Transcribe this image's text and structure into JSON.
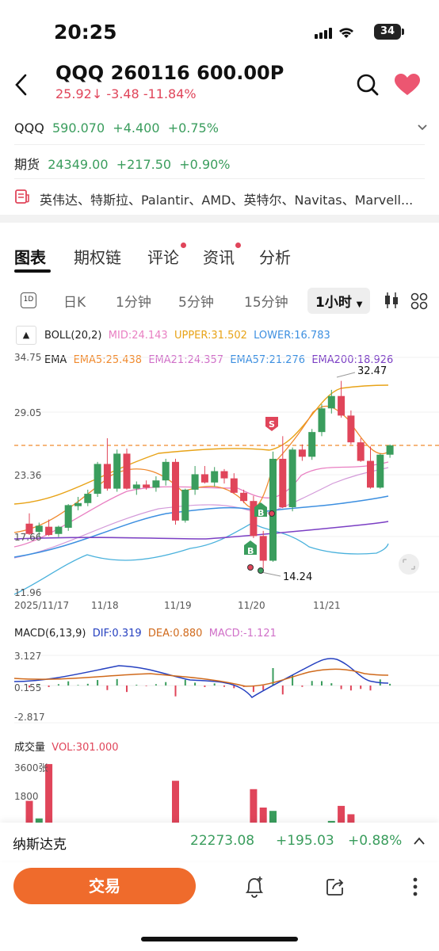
{
  "status": {
    "time": "20:25",
    "battery": "34"
  },
  "header": {
    "title": "QQQ 260116 600.00P",
    "price": "25.92",
    "change": "-3.48",
    "change_pct": "-11.84%"
  },
  "underlying": {
    "symbol": "QQQ",
    "price": "590.070",
    "change": "+4.400",
    "change_pct": "+0.75%"
  },
  "futures": {
    "label": "期货",
    "price": "24349.00",
    "change": "+217.50",
    "change_pct": "+0.90%"
  },
  "news_ticker": "英伟达、特斯拉、Palantir、AMD、英特尔、Navitas、Marvell...",
  "tabs": [
    {
      "label": "图表"
    },
    {
      "label": "期权链"
    },
    {
      "label": "评论"
    },
    {
      "label": "资讯"
    },
    {
      "label": "分析"
    }
  ],
  "periods": {
    "icon_label": "1D",
    "items": [
      "日K",
      "1分钟",
      "5分钟",
      "15分钟"
    ],
    "active": "1小时"
  },
  "boll": {
    "name": "BOLL(20,2)",
    "mid": "MID:24.143",
    "upper": "UPPER:31.502",
    "lower": "LOWER:16.783"
  },
  "ema": {
    "name": "EMA",
    "ema5": "EMA5:25.438",
    "ema21": "EMA21:24.357",
    "ema57": "EMA57:21.276",
    "ema200": "EMA200:18.926"
  },
  "price_axis": [
    "34.75",
    "29.05",
    "23.36",
    "17.66",
    "11.96"
  ],
  "date_axis": [
    "2025/11/17",
    "11/18",
    "11/19",
    "11/20",
    "11/21"
  ],
  "price_annotations": {
    "high": "32.47",
    "low": "14.24"
  },
  "markers": {
    "buy": "B",
    "sell": "S"
  },
  "macd": {
    "name": "MACD(6,13,9)",
    "dif": "DIF:0.319",
    "dea": "DEA:0.880",
    "macd": "MACD:-1.121",
    "axis": [
      "3.127",
      "0.155",
      "-2.817"
    ]
  },
  "volume": {
    "name": "成交量",
    "vol": "VOL:301.000",
    "axis": [
      "3600张",
      "1800"
    ]
  },
  "index_bar": {
    "name": "纳斯达克",
    "price": "22273.08",
    "change": "+195.03",
    "change_pct": "+0.88%"
  },
  "trade_label": "交易",
  "colors": {
    "up": "#3a9d5d",
    "down": "#e0455a",
    "accent": "#ef6b2c"
  },
  "chart_data": {
    "type": "candlestick",
    "x": [
      "2025/11/17",
      "11/18",
      "11/19",
      "11/20",
      "11/21"
    ],
    "ylim": [
      11.96,
      34.75
    ],
    "candles": [
      [
        18.6,
        19.6,
        17.5,
        17.6
      ],
      [
        17.8,
        18.7,
        17.3,
        18.4
      ],
      [
        18.3,
        19.0,
        17.4,
        17.5
      ],
      [
        17.6,
        18.4,
        17.3,
        18.3
      ],
      [
        18.2,
        20.5,
        17.9,
        20.4
      ],
      [
        20.3,
        21.2,
        19.9,
        20.6
      ],
      [
        20.6,
        21.9,
        20.3,
        21.5
      ],
      [
        21.5,
        24.6,
        21.2,
        24.4
      ],
      [
        24.4,
        26.9,
        21.8,
        22.0
      ],
      [
        22.0,
        25.8,
        21.7,
        25.4
      ],
      [
        25.4,
        25.9,
        21.9,
        22.0
      ],
      [
        22.0,
        22.7,
        21.4,
        22.4
      ],
      [
        22.4,
        22.8,
        21.9,
        22.1
      ],
      [
        22.1,
        23.2,
        21.7,
        22.8
      ],
      [
        22.8,
        24.9,
        22.3,
        24.6
      ],
      [
        24.6,
        24.9,
        18.5,
        18.9
      ],
      [
        18.9,
        22.0,
        18.7,
        21.9
      ],
      [
        21.9,
        24.2,
        21.4,
        23.4
      ],
      [
        23.4,
        24.2,
        22.5,
        22.6
      ],
      [
        22.6,
        24.1,
        22.2,
        23.7
      ],
      [
        23.7,
        23.9,
        22.5,
        23.0
      ],
      [
        23.0,
        23.5,
        21.5,
        21.6
      ],
      [
        21.6,
        21.9,
        20.6,
        20.8
      ],
      [
        20.8,
        21.3,
        17.2,
        17.4
      ],
      [
        17.4,
        17.9,
        14.24,
        15.0
      ],
      [
        15.0,
        25.6,
        14.9,
        24.9
      ],
      [
        24.9,
        27.1,
        20.1,
        20.2
      ],
      [
        20.2,
        26.0,
        19.8,
        25.8
      ],
      [
        25.8,
        26.3,
        24.7,
        25.1
      ],
      [
        25.1,
        27.8,
        24.8,
        27.5
      ],
      [
        27.5,
        30.2,
        27.1,
        29.8
      ],
      [
        29.8,
        31.6,
        29.3,
        31.0
      ],
      [
        31.0,
        32.47,
        28.9,
        29.1
      ],
      [
        29.1,
        29.6,
        26.3,
        26.5
      ],
      [
        26.5,
        26.9,
        24.6,
        24.7
      ],
      [
        24.7,
        26.1,
        22.0,
        22.1
      ],
      [
        22.1,
        25.4,
        22.0,
        25.3
      ],
      [
        25.3,
        26.3,
        25.0,
        26.2
      ]
    ],
    "volume": [
      1300,
      250,
      3500,
      0,
      0,
      0,
      0,
      0,
      0,
      0,
      0,
      0,
      0,
      0,
      0,
      2500,
      0,
      0,
      0,
      0,
      0,
      0,
      0,
      2000,
      900,
      700,
      0,
      0,
      0,
      0,
      0,
      100,
      1000,
      500
    ]
  }
}
